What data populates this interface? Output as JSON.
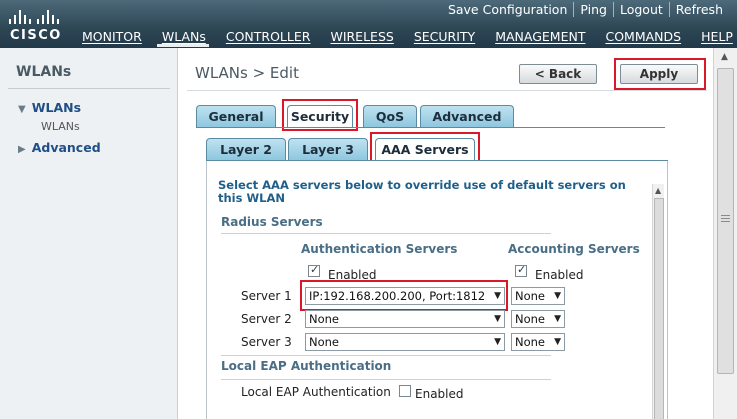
{
  "brand": {
    "name": "CISCO"
  },
  "toplinks": [
    "Save Configuration",
    "Ping",
    "Logout",
    "Refresh"
  ],
  "nav": [
    "MONITOR",
    "WLANs",
    "CONTROLLER",
    "WIRELESS",
    "SECURITY",
    "MANAGEMENT",
    "COMMANDS",
    "HELP"
  ],
  "sidebar": {
    "title": "WLANs",
    "items": [
      {
        "label": "WLANs",
        "sub": "WLANs"
      },
      {
        "label": "Advanced"
      }
    ]
  },
  "page": {
    "title": "WLANs > Edit",
    "back_label": "< Back",
    "apply_label": "Apply"
  },
  "tabs": [
    "General",
    "Security",
    "QoS",
    "Advanced"
  ],
  "subtabs": [
    "Layer 2",
    "Layer 3",
    "AAA Servers"
  ],
  "aaa": {
    "intro": "Select AAA servers below to override use of default servers on this WLAN",
    "radius_title": "Radius Servers",
    "auth_header": "Authentication Servers",
    "acct_header": "Accounting Servers",
    "enabled_label": "Enabled",
    "servers": [
      {
        "label": "Server 1",
        "auth": "IP:192.168.200.200, Port:1812",
        "acct": "None"
      },
      {
        "label": "Server 2",
        "auth": "None",
        "acct": "None"
      },
      {
        "label": "Server 3",
        "auth": "None",
        "acct": "None"
      }
    ],
    "local_eap_title": "Local EAP Authentication",
    "local_eap_label": "Local EAP Authentication",
    "local_eap_enabled": "Enabled"
  },
  "colors": {
    "header": "#2d4654",
    "tab": "#8ec7df",
    "highlight": "#d8192a",
    "link": "#1f4f86"
  }
}
